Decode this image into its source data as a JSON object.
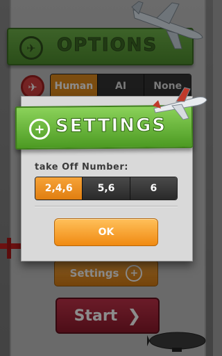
{
  "options_screen": {
    "title": "OPTIONS",
    "player_modes": [
      "Human",
      "AI",
      "None"
    ],
    "selected_player_mode": "Human",
    "settings_button_label": "Settings",
    "start_button_label": "Start"
  },
  "settings_dialog": {
    "title": "SETTINGS",
    "takeoff_label": "take Off Number:",
    "takeoff_options": [
      "2,4,6",
      "5,6",
      "6"
    ],
    "selected_takeoff": "2,4,6",
    "ok_label": "OK"
  },
  "colors": {
    "header_green": "#4c9a22",
    "accent_orange": "#f08a12",
    "start_red": "#8d1a2c"
  },
  "icons": {
    "options_icon": "airplane-icon",
    "player_icon": "airplane-icon",
    "settings_plus_icon": "plus-circle-icon",
    "start_chevron_icon": "chevron-right-icon"
  }
}
